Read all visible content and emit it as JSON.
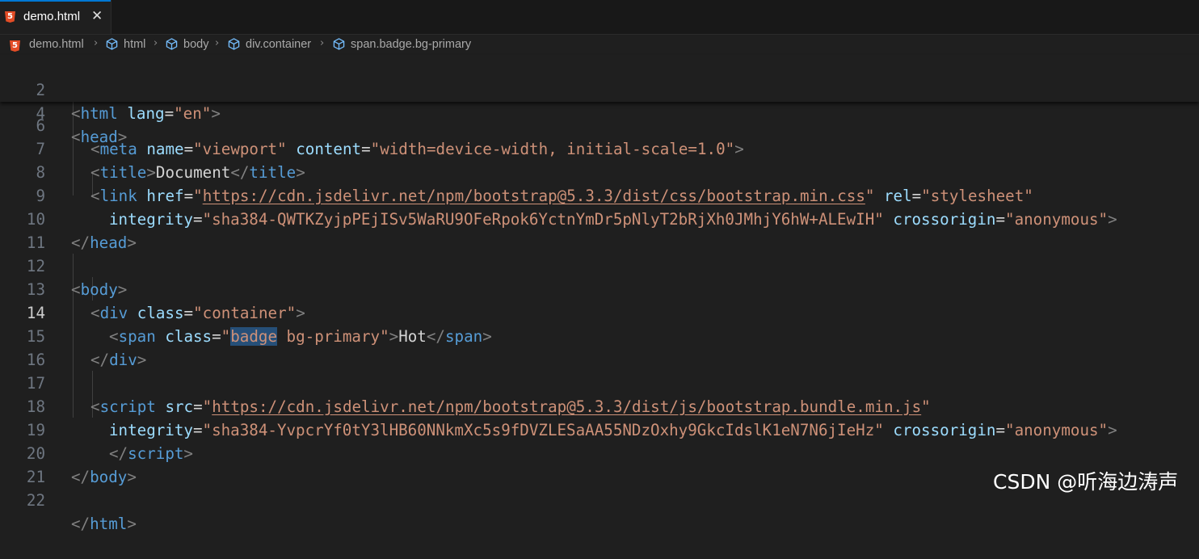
{
  "tab": {
    "filename": "demo.html",
    "close_glyph": "✕",
    "file_icon": "html5-icon"
  },
  "breadcrumb": {
    "items": [
      "demo.html",
      "html",
      "body",
      "div.container",
      "span.badge.bg-primary"
    ],
    "separator": "›"
  },
  "editor": {
    "active_line": 14,
    "line_numbers": [
      "2",
      "4",
      "6",
      "7",
      "8",
      "9",
      "10",
      "11",
      "12",
      "13",
      "14",
      "15",
      "16",
      "17",
      "18",
      "19",
      "20",
      "21",
      "22"
    ],
    "l2": {
      "lt": "<",
      "tag": "html",
      "attr": "lang",
      "eq": "=",
      "val": "\"en\"",
      "gt": ">"
    },
    "l4": {
      "lt": "<",
      "tag": "head",
      "gt": ">"
    },
    "l6": {
      "lt": "<",
      "tag": "meta",
      "attr1": "name",
      "eq": "=",
      "val1": "\"viewport\"",
      "attr2": "content",
      "val2": "\"width=device-width, initial-scale=1.0\"",
      "gt": ">"
    },
    "l7": {
      "lt": "<",
      "tag": "title",
      "gt": ">",
      "text": "Document",
      "lts": "</"
    },
    "l8": {
      "lt": "<",
      "tag": "link",
      "attr1": "href",
      "eq": "=",
      "q": "\"",
      "url": "https://cdn.jsdelivr.net/npm/bootstrap@5.3.3/dist/css/bootstrap.min.css",
      "attr2": "rel",
      "val2": "\"stylesheet\""
    },
    "l9": {
      "attr1": "integrity",
      "eq": "=",
      "val1": "\"sha384-QWTKZyjpPEjISv5WaRU9OFeRpok6YctnYmDr5pNlyT2bRjXh0JMhjY6hW+ALEwIH\"",
      "attr2": "crossorigin",
      "val2": "\"anonymous\"",
      "gt": ">"
    },
    "l10": {
      "lts": "</",
      "tag": "head",
      "gt": ">"
    },
    "l12": {
      "lt": "<",
      "tag": "body",
      "gt": ">"
    },
    "l13": {
      "lt": "<",
      "tag": "div",
      "attr": "class",
      "eq": "=",
      "val": "\"container\"",
      "gt": ">"
    },
    "l14": {
      "lt": "<",
      "tag": "span",
      "attr": "class",
      "eq": "=",
      "q": "\"",
      "word1": "badge",
      "word2": " bg-primary",
      "gt": ">",
      "text": "Hot",
      "lts": "</"
    },
    "l15": {
      "lts": "</",
      "tag": "div",
      "gt": ">"
    },
    "l17": {
      "lt": "<",
      "tag": "script",
      "attr": "src",
      "eq": "=",
      "q": "\"",
      "url": "https://cdn.jsdelivr.net/npm/bootstrap@5.3.3/dist/js/bootstrap.bundle.min.js"
    },
    "l18": {
      "attr1": "integrity",
      "eq": "=",
      "val1": "\"sha384-YvpcrYf0tY3lHB60NNkmXc5s9fDVZLESaAA55NDzOxhy9GkcIdslK1eN7N6jIeHz\"",
      "attr2": "crossorigin",
      "val2": "\"anonymous\"",
      "gt": ">"
    },
    "l19": {
      "lts": "</",
      "tag": "script",
      "gt": ">"
    },
    "l20": {
      "lts": "</",
      "tag": "body",
      "gt": ">"
    },
    "l22": {
      "lts": "</",
      "tag": "html",
      "gt": ">"
    }
  },
  "watermark": "CSDN @听海边涛声",
  "colors": {
    "tag": "#569cd6",
    "attribute": "#9cdcfe",
    "string": "#ce9178",
    "punctuation": "#808080",
    "accent": "#0078d4",
    "selection": "#264f78"
  }
}
